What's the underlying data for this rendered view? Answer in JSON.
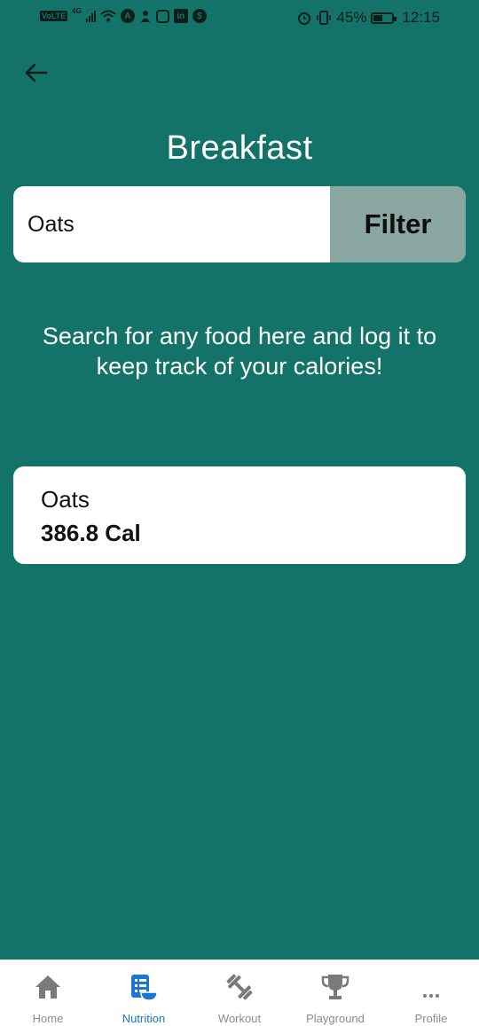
{
  "status_bar": {
    "volte": "VoLTE",
    "network": "4G",
    "battery": "45%",
    "time": "12:15",
    "icons": [
      "signal-icon",
      "wifi-icon",
      "app-icon",
      "app-icon",
      "instagram-icon",
      "linkedin-icon",
      "shield-icon",
      "alarm-icon",
      "vibrate-icon",
      "battery-icon"
    ]
  },
  "header": {
    "back_icon": "arrow-left-icon",
    "title": "Breakfast"
  },
  "search": {
    "value": "Oats",
    "filter_label": "Filter"
  },
  "info_text": "Search for any food here and log it to keep track of your calories!",
  "results": [
    {
      "name": "Oats",
      "calories": "386.8 Cal"
    }
  ],
  "bottom_nav": {
    "items": [
      {
        "label": "Home",
        "icon": "home-icon",
        "active": false
      },
      {
        "label": "Nutrition",
        "icon": "nutrition-icon",
        "active": true
      },
      {
        "label": "Workout",
        "icon": "dumbbell-icon",
        "active": false
      },
      {
        "label": "Playground",
        "icon": "trophy-icon",
        "active": false
      },
      {
        "label": "Profile",
        "icon": "more-icon",
        "active": false
      }
    ],
    "active_color": "#1976d2",
    "inactive_color": "#8c8c8c"
  },
  "colors": {
    "background": "#137368",
    "filter_button": "#8aa6a0"
  }
}
